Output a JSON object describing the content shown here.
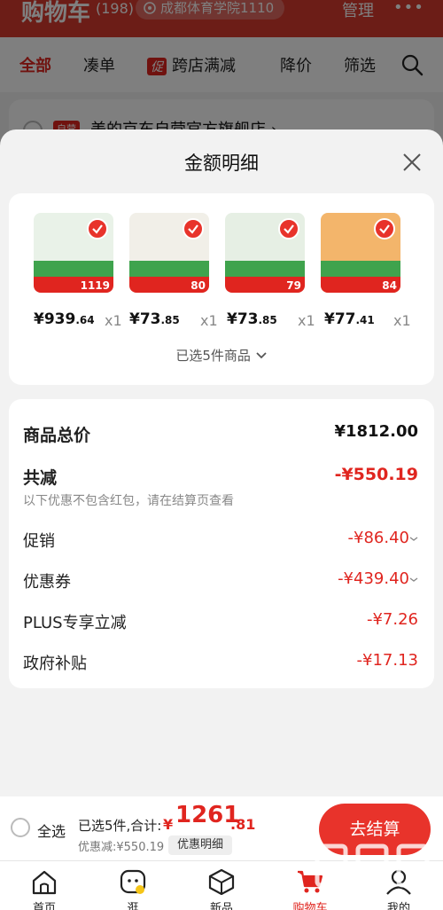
{
  "background": {
    "header": {
      "title": "购物车",
      "count": "(198)",
      "location": "成都体育学院1110",
      "manage_label": "管理",
      "more_label": "•••"
    },
    "filters": [
      "全部",
      "凑单",
      "促",
      "跨店满减",
      "降价",
      "筛选"
    ],
    "store": {
      "tag": "自营",
      "name": "美的京东自营官方旗舰店 ›"
    }
  },
  "sheet": {
    "title": "金额明细",
    "products": [
      {
        "price_int": "¥939",
        "price_dec": ".64",
        "qty": "x1",
        "badge": "1119",
        "color": "#e9f2e8"
      },
      {
        "price_int": "¥73",
        "price_dec": ".85",
        "qty": "x1",
        "badge": "80",
        "color": "#f1efe8"
      },
      {
        "price_int": "¥73",
        "price_dec": ".85",
        "qty": "x1",
        "badge": "79",
        "color": "#e6efe4"
      },
      {
        "price_int": "¥77",
        "price_dec": ".41",
        "qty": "x1",
        "badge": "84",
        "color": "#f3b56b"
      }
    ],
    "selected_label": "已选5件商品",
    "details": {
      "total_label": "商品总价",
      "total_value": "¥1812.00",
      "reduce_label": "共减",
      "reduce_value": "-¥550.19",
      "note": "以下优惠不包含红包，请在结算页查看",
      "promo_label": "促销",
      "promo_value": "-¥86.40",
      "coupon_label": "优惠券",
      "coupon_value": "-¥439.40",
      "plus_label": "PLUS专享立减",
      "plus_value": "-¥7.26",
      "gov_label": "政府补贴",
      "gov_value": "-¥17.13"
    }
  },
  "checkout": {
    "select_all": "全选",
    "summary": "已选5件,合计:",
    "currency": "¥",
    "total_int": "1261",
    "total_dec": ".81",
    "discount": "优惠减:¥550.19",
    "detail_btn": "优惠明细",
    "go_btn": "去结算"
  },
  "tabs": [
    {
      "label": "首页",
      "icon": "home-icon"
    },
    {
      "label": "逛",
      "icon": "stroll-icon"
    },
    {
      "label": "新品",
      "icon": "new-products-icon"
    },
    {
      "label": "购物车",
      "icon": "cart-icon"
    },
    {
      "label": "我的",
      "icon": "profile-icon"
    }
  ],
  "watermark": "zhizhizhi.com",
  "colors": {
    "accent": "#e0251f",
    "header": "#d83a2e"
  }
}
